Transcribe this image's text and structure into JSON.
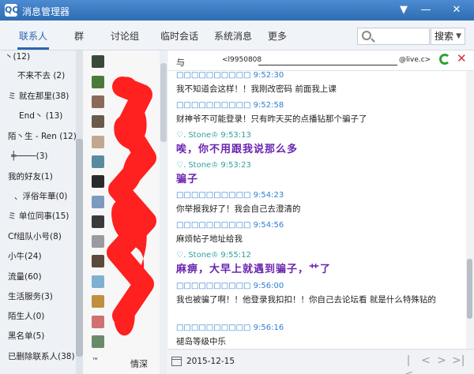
{
  "titlebar": {
    "app_icon": "QQ",
    "title": "消息管理器",
    "menu_glyph": "▼",
    "min_glyph": "—",
    "close_glyph": "✕"
  },
  "tabs": [
    {
      "label": "联系人",
      "active": true
    },
    {
      "label": "群",
      "active": false
    },
    {
      "label": "讨论组",
      "active": false
    },
    {
      "label": "临时会话",
      "active": false
    },
    {
      "label": "系统消息",
      "active": false
    },
    {
      "label": "更多",
      "active": false
    }
  ],
  "search": {
    "placeholder": "",
    "button_label": "搜索",
    "chevron": "▼"
  },
  "groups": [
    {
      "label": "丶(12)"
    },
    {
      "label": "不来不去 (2)"
    },
    {
      "label": "ミ 就在那里(38)"
    },
    {
      "label": "End丶 (13)"
    },
    {
      "label": "陌丶生 - Ren (12)"
    },
    {
      "label": "╪────(3)"
    },
    {
      "label": "我的好友(1)"
    },
    {
      "label": "、浮俗年華(0)"
    },
    {
      "label": "ミ 单位同事(15)"
    },
    {
      "label": "Cf组队小号(8)"
    },
    {
      "label": "小牛(24)"
    },
    {
      "label": "流量(60)"
    },
    {
      "label": "生活服务(3)"
    },
    {
      "label": "陌生人(0)"
    },
    {
      "label": "黑名单(5)"
    },
    {
      "label": "已删除联系人(38)"
    }
  ],
  "contact_bottom": {
    "prefix": "™",
    "name": "情深"
  },
  "conversation": {
    "with_label": "与",
    "email_start": "<l9950808",
    "email_end": "@live.c>"
  },
  "messages": [
    {
      "head": "□□□□□□□□□□ 9:52:30",
      "body": "我不知道会这样！！我刚改密码 前面我上课",
      "sender": "other",
      "big": false
    },
    {
      "head": "□□□□□□□□□□ 9:52:58",
      "body": "财神爷不可能登录！只有昨天买的点播钻那个骗子了",
      "sender": "other",
      "big": false
    },
    {
      "head": "♡. Stone♔ 9:53:13",
      "body": "唉，你不用跟我说那么多",
      "sender": "self",
      "big": true
    },
    {
      "head": "♡. Stone♔ 9:53:23",
      "body": "骗子",
      "sender": "self",
      "big": true
    },
    {
      "head": "□□□□□□□□□□ 9:54:23",
      "body": "你举报我好了！我会自己去澄清的",
      "sender": "other",
      "big": false
    },
    {
      "head": "□□□□□□□□□□ 9:54:56",
      "body": "麻烦帖子地址给我",
      "sender": "other",
      "big": false
    },
    {
      "head": "♡. Stone♔ 9:55:12",
      "body": "麻痹，大早上就遇到骗子，艹了",
      "sender": "self",
      "big": true
    },
    {
      "head": "□□□□□□□□□□ 9:56:00",
      "body": "我也被骗了啊！！他登录我扣扣！！你自己去论坛看 就是什么特殊钻的",
      "sender": "other",
      "big": false
    },
    {
      "head": "□□□□□□□□□□ 9:56:16",
      "body": "褪岛等级中乐",
      "sender": "other",
      "big": false
    }
  ],
  "bottom": {
    "date": "2015-12-15",
    "nav": [
      "|<",
      "<",
      ">",
      ">|"
    ]
  },
  "colors": {
    "accent": "#2b66b1",
    "titlebar": "#3a78bf",
    "self_msg": "#6a24b0",
    "other_head": "#2f7fd0",
    "redaction": "#ff2020"
  }
}
